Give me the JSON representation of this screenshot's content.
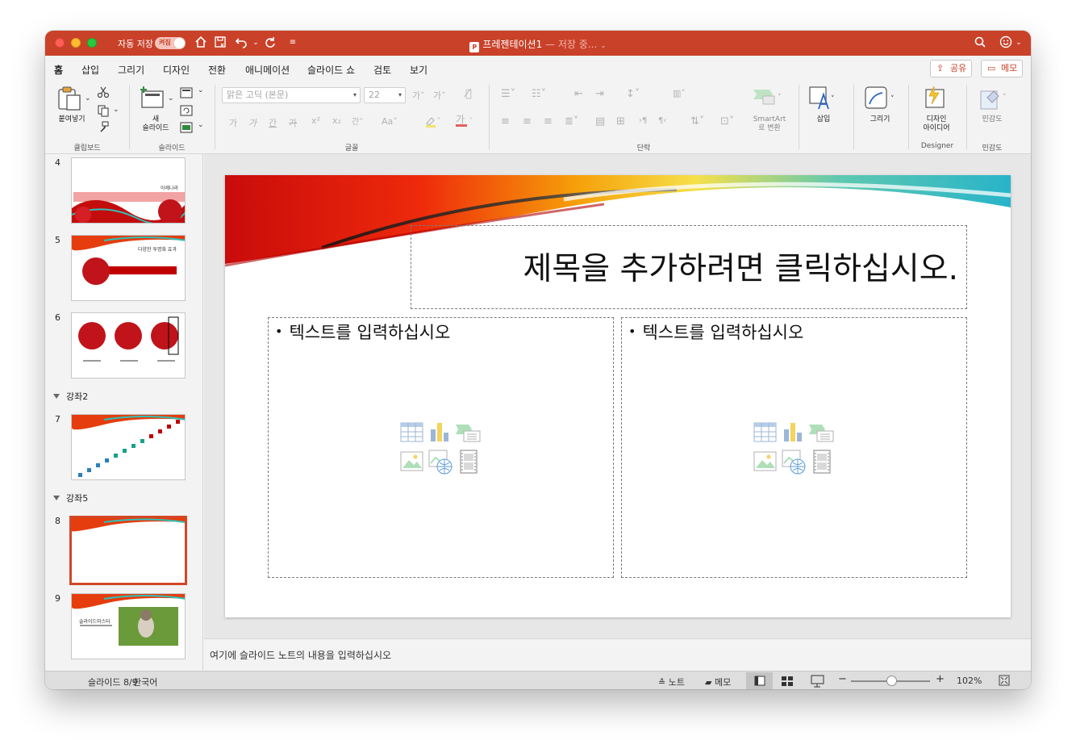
{
  "titlebar": {
    "autosave_label": "자동 저장",
    "autosave_state": "켜짐",
    "doc_name": "프레젠테이션1",
    "saving_status": "— 저장 중..."
  },
  "tabs": [
    {
      "label": "홈",
      "active": true
    },
    {
      "label": "삽입"
    },
    {
      "label": "그리기"
    },
    {
      "label": "디자인"
    },
    {
      "label": "전환"
    },
    {
      "label": "애니메이션"
    },
    {
      "label": "슬라이드 쇼"
    },
    {
      "label": "검토"
    },
    {
      "label": "보기"
    }
  ],
  "share_label": "공유",
  "memo_label": "메모",
  "ribbon": {
    "paste_label": "붙여넣기",
    "new_slide_label_1": "새",
    "new_slide_label_2": "슬라이드",
    "font_name": "맑은 고딕 (본문)",
    "font_size": "22",
    "font_buttons": [
      "가",
      "가",
      "간",
      "가"
    ],
    "smartart_label_1": "SmartArt",
    "smartart_label_2": "로 변환",
    "insert_label": "삽입",
    "draw_label": "그리기",
    "design_ideas_1": "디자인",
    "design_ideas_2": "아이디어",
    "sensitivity_label": "민감도",
    "groups": {
      "clipboard": "클립보드",
      "slides": "슬라이드",
      "font": "글꼴",
      "paragraph": "단락",
      "designer": "Designer",
      "sensitivity": "민감도"
    }
  },
  "slides_panel": {
    "slide4": {
      "number": "4",
      "caption": "아제나라"
    },
    "slide5": {
      "number": "5",
      "caption": "다양한 투명화 효과"
    },
    "slide6": {
      "number": "6"
    },
    "section2": "강좌2",
    "slide7": {
      "number": "7"
    },
    "section5": "강좌5",
    "slide8": {
      "number": "8"
    },
    "slide9": {
      "number": "9",
      "caption": "슬라이드마스터"
    }
  },
  "slide": {
    "title_placeholder": "제목을 추가하려면 클릭하십시오.",
    "text_placeholder_left": "텍스트를 입력하십시오",
    "text_placeholder_right": "텍스트를 입력하십시오"
  },
  "notes_placeholder": "여기에 슬라이드 노트의 내용을 입력하십시오",
  "status": {
    "slide_counter": "슬라이드 8/9",
    "language": "한국어",
    "notes_label": "노트",
    "comments_label": "메모",
    "zoom": "102%",
    "zoom_minus": "−",
    "zoom_plus": "+"
  },
  "colors": {
    "accent": "#c94129",
    "selected_thumb": "#d24726",
    "titlebar": "#c94129"
  }
}
